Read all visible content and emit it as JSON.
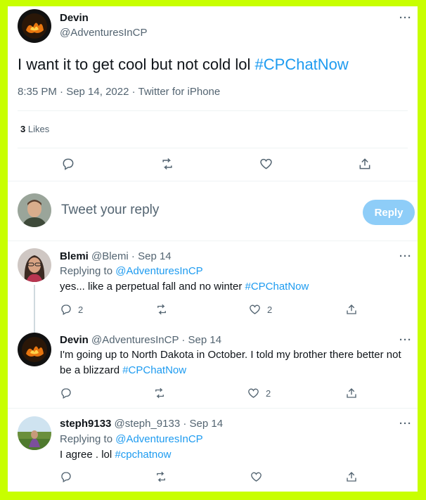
{
  "main_tweet": {
    "name": "Devin",
    "handle": "@AdventuresInCP",
    "text_plain": "I want it to get cool but not cold lol ",
    "text_hashtag": "#CPChatNow",
    "timestamp": "8:35 PM · Sep 14, 2022 · Twitter for iPhone",
    "likes_count": "3",
    "likes_label": "Likes",
    "more": "···"
  },
  "composer": {
    "placeholder": "Tweet your reply",
    "button_label": "Reply"
  },
  "replies": [
    {
      "name": "Blemi",
      "handle_meta": "@Blemi · Sep 14",
      "replying_prefix": "Replying to ",
      "replying_to": "@AdventuresInCP",
      "text_plain": "yes... like a perpetual fall and no winter ",
      "text_hashtag": "#CPChatNow",
      "reply_count": "2",
      "like_count": "2",
      "more": "···"
    },
    {
      "name": "Devin",
      "handle_meta": "@AdventuresInCP · Sep 14",
      "text_line1": "I'm going up to North Dakota in October. I told my brother there better not",
      "text_line2_plain": "be a blizzard ",
      "text_hashtag": "#CPChatNow",
      "like_count": "2",
      "more": "···"
    },
    {
      "name": "steph9133",
      "handle_meta": "@steph_9133 · Sep 14",
      "replying_prefix": "Replying to ",
      "replying_to": "@AdventuresInCP",
      "text_plain": "I agree . lol ",
      "text_hashtag": "#cpchatnow",
      "more": "···"
    }
  ],
  "colors": {
    "accent": "#1d9bf0",
    "frame": "#c8ff00",
    "muted": "#536471",
    "reply_button": "#8ecdf8"
  }
}
